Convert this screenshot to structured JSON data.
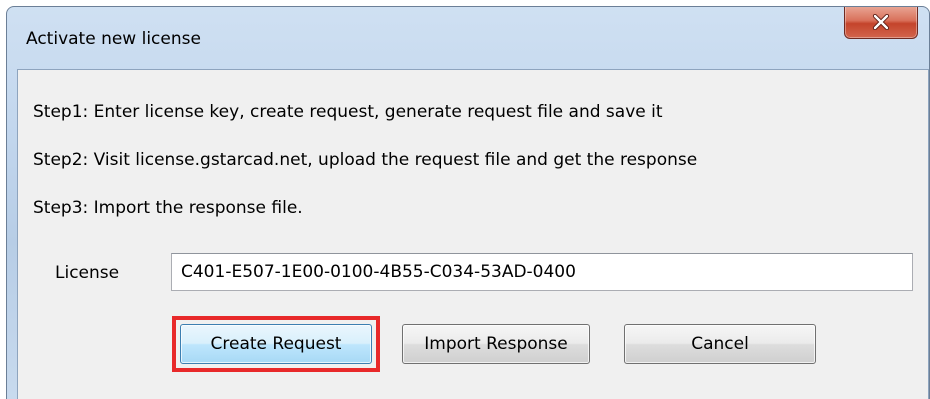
{
  "window": {
    "title": "Activate new license",
    "close_label": "x"
  },
  "steps": [
    "Step1: Enter license key, create request, generate request file and save it",
    "Step2: Visit license.gstarcad.net, upload the request file and get the response",
    "Step3: Import the response file."
  ],
  "license": {
    "label": "License",
    "value": "C401-E507-1E00-0100-4B55-C034-53AD-0400"
  },
  "buttons": {
    "create_request": "Create Request",
    "import_response": "Import Response",
    "cancel": "Cancel"
  },
  "colors": {
    "highlight": "#e8292a",
    "close_button": "#c4442b",
    "titlebar": "#c3d7ee"
  }
}
